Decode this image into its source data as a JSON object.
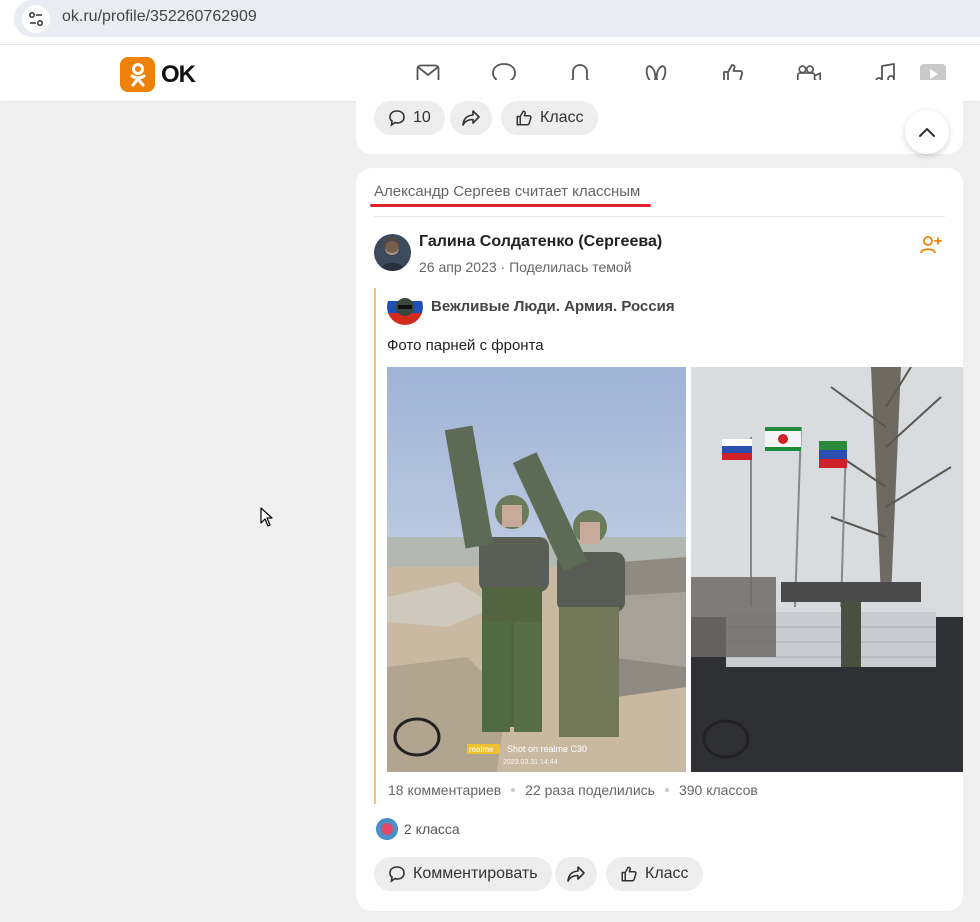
{
  "browser": {
    "url": "ok.ru/profile/352260762909"
  },
  "header": {
    "logo_text": "OK",
    "nav_icons": [
      "mail-icon",
      "chat-icon",
      "bell-icon",
      "guests-icon",
      "like-icon",
      "video-icon",
      "music-icon",
      "play-icon"
    ]
  },
  "prev_post": {
    "comments_count": "10",
    "class_label": "Класс"
  },
  "feed_item": {
    "liked_by": "Александр Сергеев считает классным",
    "author": "Галина Солдатенко (Сергеева)",
    "meta": "26 апр 2023 · Поделилась темой",
    "group": "Вежливые Люди. Армия. Россия",
    "text": "Фото парней с фронта",
    "photo_watermark": "Shot on realme C30",
    "photo_watermark_brand": "realme",
    "photo_timestamp": "2023.03.31 14:44",
    "stats": {
      "comments": "18 комментариев",
      "shares": "22 раза поделились",
      "classes": "390 классов"
    },
    "likes_summary": "2 класса",
    "actions": {
      "comment": "Комментировать",
      "class": "Класс"
    }
  },
  "colors": {
    "ok_orange": "#ee8208",
    "accent_red": "#e0202a",
    "quote_bar": "#f3c289"
  }
}
